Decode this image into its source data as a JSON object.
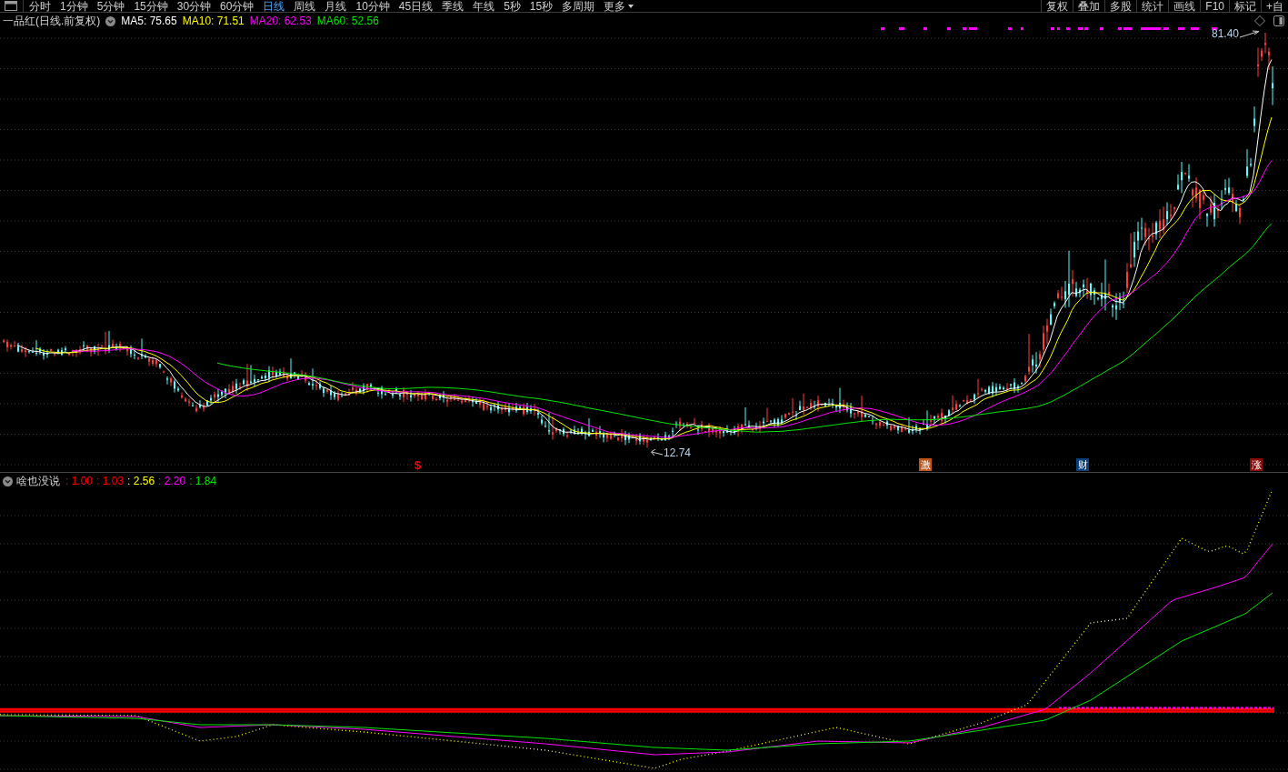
{
  "toolbar": {
    "periods": [
      {
        "label": "分时",
        "selected": false,
        "kind": "tab"
      },
      {
        "label": "1分钟",
        "selected": false,
        "kind": "tab"
      },
      {
        "label": "5分钟",
        "selected": false,
        "kind": "tab"
      },
      {
        "label": "15分钟",
        "selected": false,
        "kind": "tab"
      },
      {
        "label": "30分钟",
        "selected": false,
        "kind": "tab"
      },
      {
        "label": "60分钟",
        "selected": false,
        "kind": "tab"
      },
      {
        "label": "日线",
        "selected": true,
        "kind": "tab"
      },
      {
        "label": "周线",
        "selected": false,
        "kind": "tab"
      },
      {
        "label": "月线",
        "selected": false,
        "kind": "tab"
      },
      {
        "label": "10分钟",
        "selected": false,
        "kind": "tab"
      },
      {
        "label": "45日线",
        "selected": false,
        "kind": "tab"
      },
      {
        "label": "季线",
        "selected": false,
        "kind": "tab"
      },
      {
        "label": "年线",
        "selected": false,
        "kind": "tab"
      },
      {
        "label": "5秒",
        "selected": false,
        "kind": "tab"
      },
      {
        "label": "15秒",
        "selected": false,
        "kind": "tab"
      },
      {
        "label": "多周期",
        "selected": false,
        "kind": "tab"
      },
      {
        "label": "更多",
        "selected": false,
        "kind": "menu"
      }
    ],
    "tools": [
      "复权",
      "叠加",
      "多股",
      "统计",
      "画线",
      "F10",
      "标记",
      "+自"
    ]
  },
  "main_chart": {
    "title": "一品红(日线.前复权)",
    "indicators": [
      {
        "text": "MA5: 75.65",
        "color": "#ffffff"
      },
      {
        "text": "MA10: 71.51",
        "color": "#ffff00"
      },
      {
        "text": "MA20: 62.53",
        "color": "#ff00ff"
      },
      {
        "text": "MA60: 52.56",
        "color": "#00e600"
      }
    ],
    "price_labels": [
      {
        "kind": "high",
        "text": "81.40"
      },
      {
        "kind": "low",
        "text": "12.74"
      }
    ],
    "signals": [
      {
        "kind": "plain",
        "text": "$",
        "color": "#ff0000"
      },
      {
        "kind": "tile",
        "text": "激",
        "color": "#c0561b"
      },
      {
        "kind": "tile",
        "text": "财",
        "color": "#0b3f7a"
      },
      {
        "kind": "tile",
        "text": "涨",
        "color": "#8c0a0a"
      }
    ]
  },
  "indicator_chart": {
    "title": "啥也没说",
    "values": [
      {
        "text": ": 1.00",
        "color": "#ff0000"
      },
      {
        "text": ": 1.03",
        "color": "#ff0000"
      },
      {
        "text": ": 2.56",
        "color": "#ffff00"
      },
      {
        "text": ": 2.20",
        "color": "#ff00ff"
      },
      {
        "text": ": 1.84",
        "color": "#00e600"
      }
    ]
  }
}
